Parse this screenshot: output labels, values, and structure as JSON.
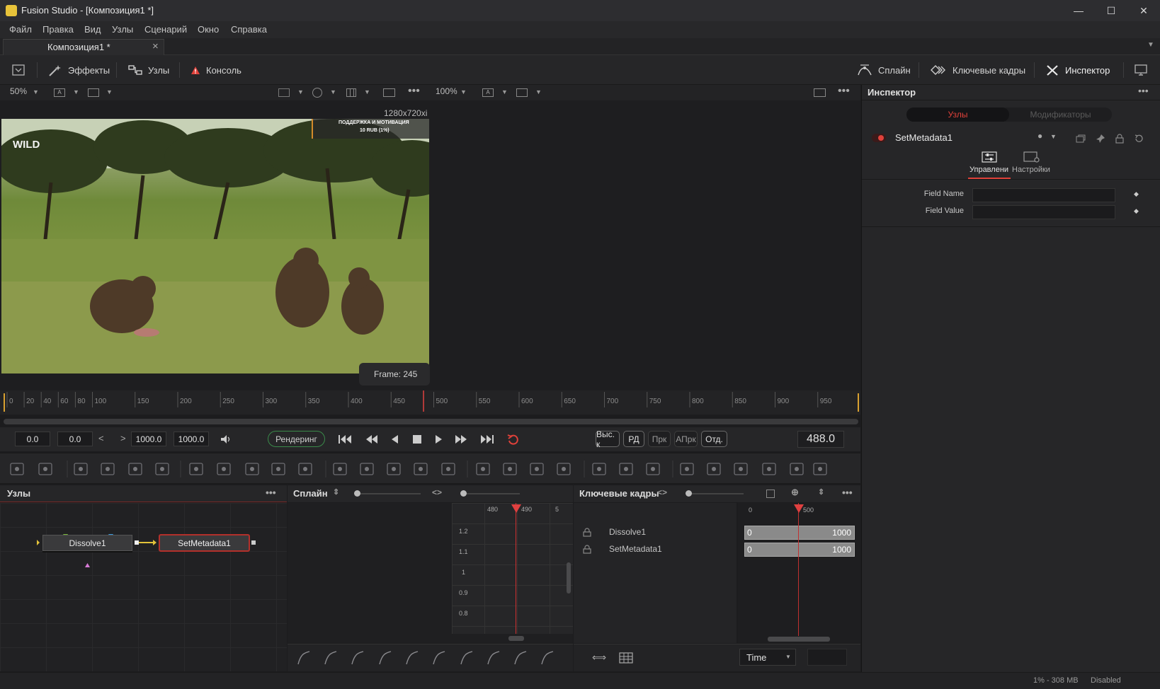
{
  "window": {
    "title": "Fusion Studio - [Композиция1 *]",
    "minimize": "—",
    "maximize": "☐",
    "close": "✕"
  },
  "menu": [
    "Файл",
    "Правка",
    "Вид",
    "Узлы",
    "Сценарий",
    "Окно",
    "Справка"
  ],
  "doc_tab": {
    "label": "Композиция1 *",
    "close": "×"
  },
  "toolbar": {
    "effects": "Эффекты",
    "nodes": "Узлы",
    "console": "Консоль",
    "spline": "Сплайн",
    "keyframes": "Ключевые кадры",
    "inspector": "Инспектор"
  },
  "viewer": {
    "zoom_left": "50%",
    "zoom_right": "100%",
    "resolution": "1280x720xi",
    "frame_label": "Frame: 245",
    "overlay_line1": "ПОДДЕРЖКА И МОТИВАЦИЯ",
    "overlay_line2": "10 RUB (1%)",
    "logo_text": "WILD"
  },
  "ruler": {
    "ticks": [
      "0",
      "20",
      "40",
      "60",
      "80",
      "100",
      "150",
      "200",
      "250",
      "300",
      "350",
      "400",
      "450",
      "500",
      "550",
      "600",
      "650",
      "700",
      "750",
      "800",
      "850",
      "900",
      "950"
    ],
    "playhead": 488
  },
  "transport": {
    "start": "0.0",
    "render_start": "0.0",
    "render_end": "1000.0",
    "end": "1000.0",
    "render_button": "Рендеринг",
    "quality_buttons": [
      "Выс. к",
      "РД",
      "Прк",
      "АПрк",
      "Отд."
    ],
    "current_time": "488.0"
  },
  "nodes_panel": {
    "title": "Узлы",
    "node1": "Dissolve1",
    "node2": "SetMetadata1"
  },
  "spline_panel": {
    "title": "Сплайн",
    "x_ticks": [
      "480",
      "490",
      "5"
    ],
    "y_ticks": [
      "1.2",
      "1.1",
      "1",
      "0.9",
      "0.8"
    ]
  },
  "keyframes_panel": {
    "title": "Ключевые кадры",
    "tracks": [
      {
        "name": "Dissolve1",
        "start": "0",
        "end": "1000"
      },
      {
        "name": "SetMetadata1",
        "start": "0",
        "end": "1000"
      }
    ],
    "time_ticks": [
      "0",
      "500"
    ],
    "time_mode": "Time"
  },
  "inspector": {
    "title": "Инспектор",
    "tab_nodes": "Узлы",
    "tab_modifiers": "Модификаторы",
    "node_name": "SetMetadata1",
    "subtab_controls": "Управлени",
    "subtab_settings": "Настройки",
    "field_name_label": "Field Name",
    "field_value_label": "Field Value",
    "field_name_value": "",
    "field_value_value": ""
  },
  "status": {
    "memory": "1% - 308 MB",
    "state": "Disabled"
  },
  "colors": {
    "accent_red": "#e0413a",
    "playhead": "#e04040",
    "bg": "#1c1c1e"
  }
}
